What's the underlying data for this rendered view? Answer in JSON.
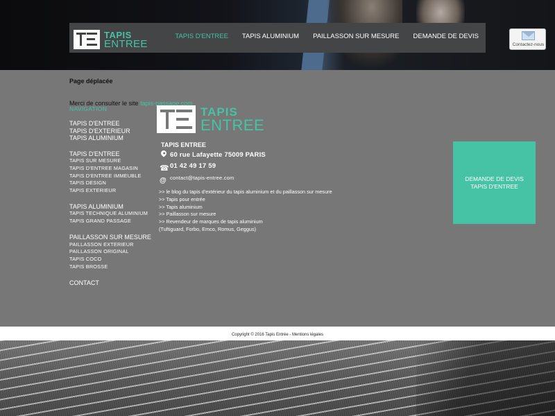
{
  "header": {
    "logo_line1": "TAPIS",
    "logo_line2": "ENTREE",
    "menu": [
      {
        "label": "TAPIS D'ENTREE",
        "active": true
      },
      {
        "label": "TAPIS ALUMINIUM",
        "active": false
      },
      {
        "label": "PAILLASSON SUR MESURE",
        "active": false
      },
      {
        "label": "DEMANDE DE DEVIS",
        "active": false
      }
    ],
    "contact_button": "Contactez-nous"
  },
  "notice": {
    "title": "Page déplacée",
    "message": "Merci de consulter le site",
    "link": "tapis-passage.com"
  },
  "sitemap": {
    "heading": "NAVIGATION",
    "group1": [
      "TAPIS D'ENTREE",
      "TAPIS D'EXTERIEUR",
      "TAPIS ALUMINIUM"
    ],
    "group2_title": "TAPIS D'ENTREE",
    "group2": [
      "TAPIS SUR MESURE",
      "TAPIS D'ENTREE MAGASIN",
      "TAPIS D'ENTREE IMMEUBLE",
      "TAPIS DESIGN",
      "TAPIS EXTERIEUR"
    ],
    "group3_title": "TAPIS ALUMINIUM",
    "group3": [
      "TAPIS TECHNIQUE ALUMINIUM",
      "TAPIS GRAND PASSAGE"
    ],
    "group4_title": "PAILLASSON SUR MESURE",
    "group4": [
      "PAILLASSON EXTERIEUR",
      "PAILLASSON ORIGINAL",
      "TAPIS COCO",
      "TAPIS BROSSE"
    ],
    "contact": "CONTACT"
  },
  "company": {
    "logo_line1": "TAPIS",
    "logo_line2": "ENTREE",
    "name": "TAPIS ENTREE",
    "address": "60 rue Lafayette 75009 PARIS",
    "phone": "01 42 49 17 59",
    "email": "contact@tapis-entree.com",
    "links": [
      ">> le blog du tapis d'extérieur du tapis aluminium et du paillasson sur mesure",
      ">> Tapis pour entrée",
      ">> Tapis aluminium",
      ">> Paillasson sur mesure",
      ">> Revendeur de marques de tapis aluminium",
      "(Tuftiguard, Forbo, Emco, Romus, Geggus)"
    ]
  },
  "cta": {
    "line1": "DEMANDE DE DEVIS",
    "line2": "TAPIS D'ENTREE"
  },
  "footer": {
    "text": "Copyright © 2016 Tapis Entrée - Mentions légales"
  },
  "colors": {
    "accent": "#46c3a4",
    "main_bg": "#777777",
    "navbar_bg": "#444547"
  }
}
